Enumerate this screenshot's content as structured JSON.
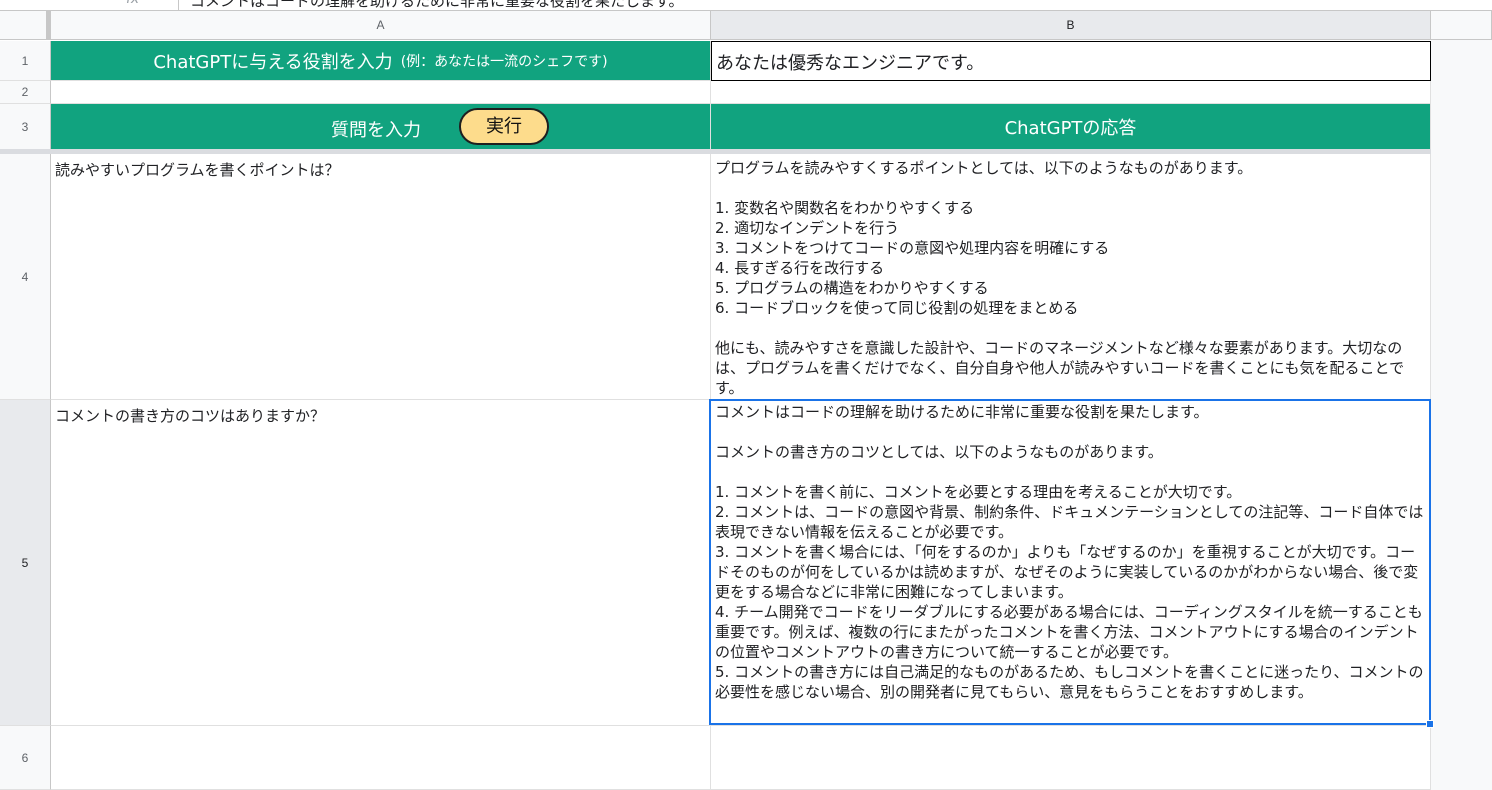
{
  "formula_bar": {
    "fx_label": "fx",
    "content": "コメントはコードの理解を助けるために非常に重要な役割を果たします。"
  },
  "columns": [
    "A",
    "B"
  ],
  "rows": [
    "1",
    "2",
    "3",
    "4",
    "5",
    "6"
  ],
  "cells": {
    "A1": {
      "main": "ChatGPTに与える役割を入力",
      "sub": "(例：あなたは一流のシェフです)"
    },
    "B1": "あなたは優秀なエンジニアです。",
    "A3": "質問を入力",
    "run_button": "実行",
    "B3": "ChatGPTの応答",
    "A4": "読みやすいプログラムを書くポイントは？",
    "B4": "プログラムを読みやすくするポイントとしては、以下のようなものがあります。\n\n1. 変数名や関数名をわかりやすくする\n2. 適切なインデントを行う\n3. コメントをつけてコードの意図や処理内容を明確にする\n4. 長すぎる行を改行する\n5. プログラムの構造をわかりやすくする\n6. コードブロックを使って同じ役割の処理をまとめる\n\n他にも、読みやすさを意識した設計や、コードのマネージメントなど様々な要素があります。大切なのは、プログラムを書くだけでなく、自分自身や他人が読みやすいコードを書くことにも気を配ることです。",
    "A5": "コメントの書き方のコツはありますか？",
    "B5": "コメントはコードの理解を助けるために非常に重要な役割を果たします。\n\nコメントの書き方のコツとしては、以下のようなものがあります。\n\n1. コメントを書く前に、コメントを必要とする理由を考えることが大切です。\n2. コメントは、コードの意図や背景、制約条件、ドキュメンテーションとしての注記等、コード自体では表現できない情報を伝えることが必要です。\n3. コメントを書く場合には、「何をするのか」よりも「なぜするのか」を重視することが大切です。コードそのものが何をしているかは読めますが、なぜそのように実装しているのかがわからない場合、後で変更をする場合などに非常に困難になってしまいます。\n4. チーム開発でコードをリーダブルにする必要がある場合には、コーディングスタイルを統一することも重要です。例えば、複数の行にまたがったコメントを書く方法、コメントアウトにする場合のインデントの位置やコメントアウトの書き方について統一することが必要です。\n5. コメントの書き方には自己満足的なものがあるため、もしコメントを書くことに迷ったり、コメントの必要性を感じない場合、別の開発者に見てもらい、意見をもらうことをおすすめします。"
  },
  "colors": {
    "header_green": "#11a37f",
    "button_yellow": "#fddc8c",
    "selection_blue": "#1a73e8"
  }
}
